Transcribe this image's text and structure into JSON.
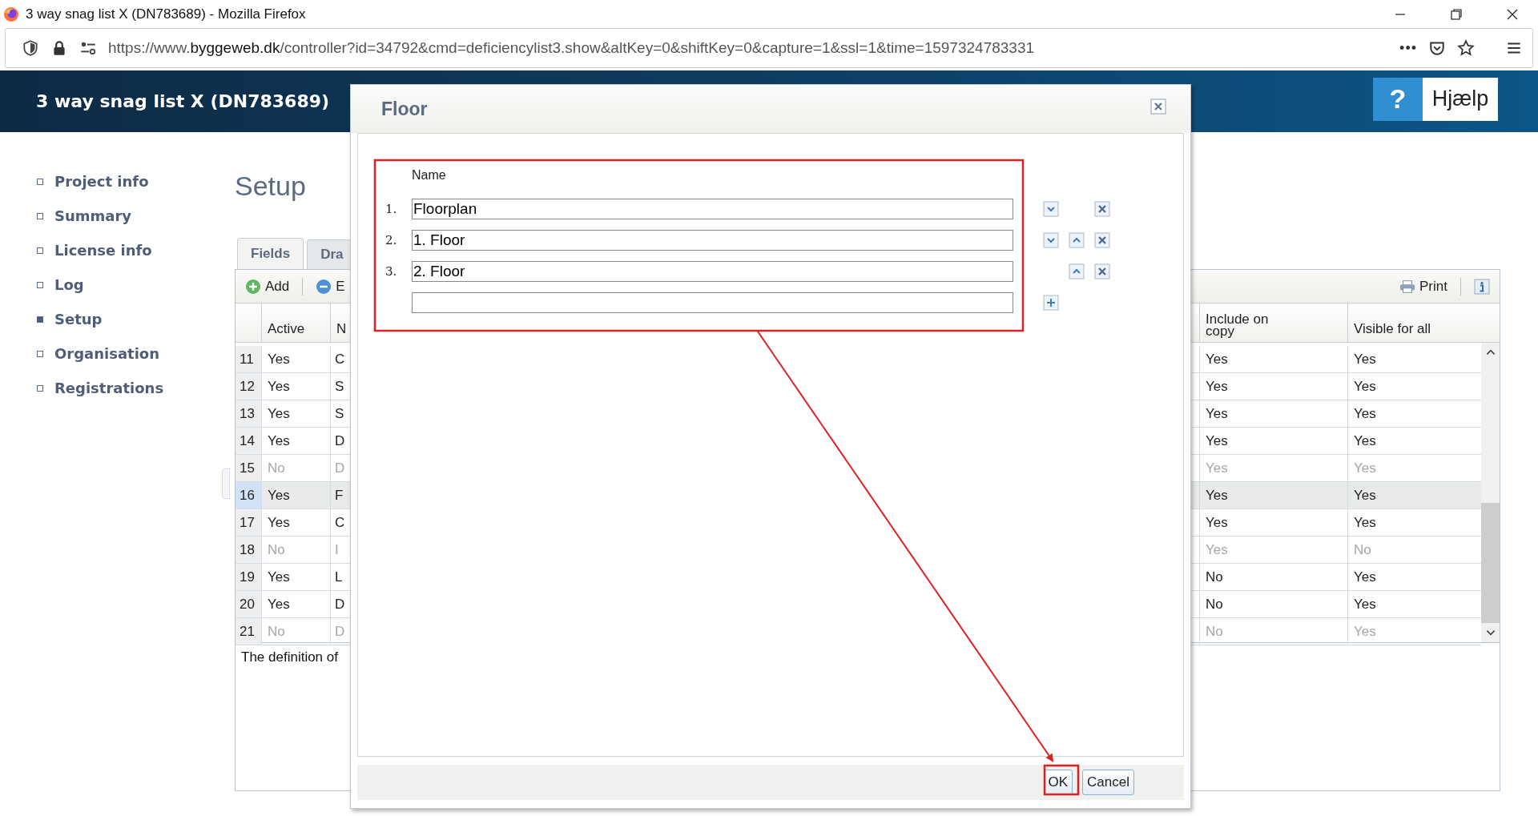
{
  "browser": {
    "title": "3 way snag list X (DN783689) - Mozilla Firefox",
    "url": {
      "prefix": "https://www.",
      "domain": "byggeweb.dk",
      "path": "/controller?id=34792&cmd=deficiencylist3.show&altKey=0&shiftKey=0&capture=1&ssl=1&time=1597324783331"
    },
    "menu_dots": "•••"
  },
  "header": {
    "title": "3 way snag list X (DN783689)",
    "help_icon": "?",
    "help_label": "Hjælp"
  },
  "sidebar": {
    "items": [
      {
        "label": "Project info",
        "selected": false
      },
      {
        "label": "Summary",
        "selected": false
      },
      {
        "label": "License info",
        "selected": false
      },
      {
        "label": "Log",
        "selected": false
      },
      {
        "label": "Setup",
        "selected": true
      },
      {
        "label": "Organisation",
        "selected": false
      },
      {
        "label": "Registrations",
        "selected": false
      }
    ]
  },
  "page": {
    "heading": "Setup",
    "tabs": [
      {
        "label": "Fields",
        "selected": true
      },
      {
        "label": "Dra",
        "selected": false
      }
    ],
    "toolbar": {
      "add": "Add",
      "edit": "E",
      "print": "Print"
    },
    "table": {
      "columns": [
        "Active",
        "N",
        "Include on copy",
        "Visible for all"
      ],
      "rows": [
        {
          "number": "11",
          "active": "Yes",
          "name": "C",
          "include": "Yes",
          "visible": "Yes",
          "disabled": false,
          "selected": false
        },
        {
          "number": "12",
          "active": "Yes",
          "name": "S",
          "include": "Yes",
          "visible": "Yes",
          "disabled": false,
          "selected": false
        },
        {
          "number": "13",
          "active": "Yes",
          "name": "S",
          "include": "Yes",
          "visible": "Yes",
          "disabled": false,
          "selected": false
        },
        {
          "number": "14",
          "active": "Yes",
          "name": "D",
          "include": "Yes",
          "visible": "Yes",
          "disabled": false,
          "selected": false
        },
        {
          "number": "15",
          "active": "No",
          "name": "D",
          "include": "Yes",
          "visible": "Yes",
          "disabled": true,
          "selected": false
        },
        {
          "number": "16",
          "active": "Yes",
          "name": "F",
          "include": "Yes",
          "visible": "Yes",
          "disabled": false,
          "selected": true
        },
        {
          "number": "17",
          "active": "Yes",
          "name": "C",
          "include": "Yes",
          "visible": "Yes",
          "disabled": false,
          "selected": false
        },
        {
          "number": "18",
          "active": "No",
          "name": "I",
          "include": "Yes",
          "visible": "No",
          "disabled": true,
          "selected": false
        },
        {
          "number": "19",
          "active": "Yes",
          "name": "L",
          "include": "No",
          "visible": "Yes",
          "disabled": false,
          "selected": false
        },
        {
          "number": "20",
          "active": "Yes",
          "name": "D",
          "include": "No",
          "visible": "Yes",
          "disabled": false,
          "selected": false
        },
        {
          "number": "21",
          "active": "No",
          "name": "D",
          "include": "No",
          "visible": "Yes",
          "disabled": true,
          "selected": false
        }
      ]
    },
    "footnote": "The definition of"
  },
  "dialog": {
    "title": "Floor",
    "column_label": "Name",
    "entries": [
      {
        "index": "1.",
        "value": "Floorplan",
        "can_move_down": true,
        "can_move_up": false,
        "deletable": true
      },
      {
        "index": "2.",
        "value": "1. Floor",
        "can_move_down": true,
        "can_move_up": true,
        "deletable": true
      },
      {
        "index": "3.",
        "value": "2. Floor",
        "can_move_down": false,
        "can_move_up": true,
        "deletable": true
      }
    ],
    "show_add_row": true,
    "buttons": [
      "OK",
      "Cancel"
    ]
  }
}
